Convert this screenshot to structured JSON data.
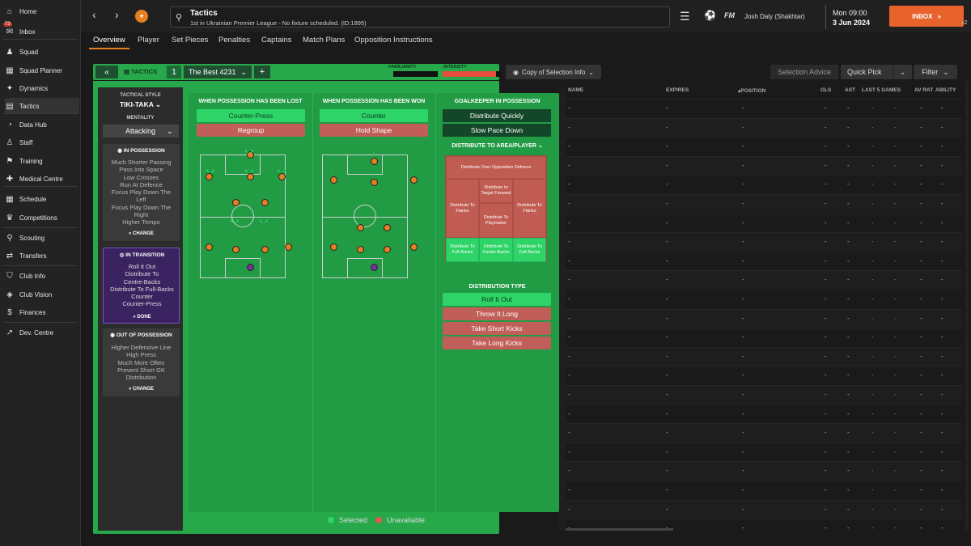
{
  "sidebar": {
    "items": [
      {
        "label": "Home",
        "icon": "home-icon"
      },
      {
        "label": "Inbox",
        "icon": "inbox-icon",
        "badge": "73"
      },
      {
        "label": "Squad",
        "icon": "squad-icon"
      },
      {
        "label": "Squad Planner",
        "icon": "planner-icon"
      },
      {
        "label": "Dynamics",
        "icon": "dynamics-icon"
      },
      {
        "label": "Tactics",
        "icon": "tactics-icon",
        "active": true
      },
      {
        "label": "Data Hub",
        "icon": "data-hub-icon"
      },
      {
        "label": "Staff",
        "icon": "staff-icon"
      },
      {
        "label": "Training",
        "icon": "training-icon"
      },
      {
        "label": "Medical Centre",
        "icon": "medical-icon"
      },
      {
        "label": "Schedule",
        "icon": "calendar-icon"
      },
      {
        "label": "Competitions",
        "icon": "trophy-icon"
      },
      {
        "label": "Scouting",
        "icon": "scouting-icon"
      },
      {
        "label": "Transfers",
        "icon": "transfers-icon"
      },
      {
        "label": "Club Info",
        "icon": "shield-icon"
      },
      {
        "label": "Club Vision",
        "icon": "vision-icon"
      },
      {
        "label": "Finances",
        "icon": "finances-icon"
      },
      {
        "label": "Dev. Centre",
        "icon": "dev-centre-icon"
      }
    ]
  },
  "topbar": {
    "title": "Tactics",
    "subtitle": "1st in Ukrainian Premier League - No fixture scheduled. (ID:1895)",
    "fm_logo": "FM",
    "manager": "Josh Daly (Shakhtar)",
    "date_day": "Mon 09:00",
    "date": "3 Jun 2024",
    "inbox_label": "INBOX",
    "bell_count": "2"
  },
  "tabs": [
    "Overview",
    "Player",
    "Set Pieces",
    "Penalties",
    "Captains",
    "Match Plans",
    "Opposition Instructions"
  ],
  "tactics_bar": {
    "label": "TACTICS",
    "slot": "1",
    "name": "The Best 4231",
    "familiarity_label": "FAMILIARITY",
    "intensity_label": "INTENSITY",
    "familiarity": 0.12,
    "intensity": 0.92
  },
  "left_panel": {
    "style_label": "TACTICAL STYLE",
    "style": "TIKI-TAKA",
    "mentality_label": "MENTALITY",
    "mentality": "Attacking",
    "in_possession": {
      "title": "IN POSSESSION",
      "lines": [
        "Much Shorter Passing",
        "Pass Into Space",
        "Low Crosses",
        "Run At Defence",
        "Focus Play Down The",
        "Left",
        "Focus Play Down The",
        "Right",
        "Higher Tempo"
      ],
      "action": "CHANGE"
    },
    "in_transition": {
      "title": "IN TRANSITION",
      "lines": [
        "Roll It Out",
        "Distribute To",
        "Centre-Backs",
        "Distribute To Full-Backs",
        "Counter",
        "Counter-Press"
      ],
      "action": "DONE"
    },
    "out_of_possession": {
      "title": "OUT OF POSSESSION",
      "lines": [
        "Higher Defensive Line",
        "High Press",
        "Much More Often",
        "Prevent Short GK",
        "Distribution"
      ],
      "action": "CHANGE"
    }
  },
  "transition": {
    "lost": {
      "title": "WHEN POSSESSION HAS BEEN LOST",
      "options": [
        {
          "label": "Counter-Press",
          "state": "selected"
        },
        {
          "label": "Regroup",
          "state": "unavailable"
        }
      ]
    },
    "won": {
      "title": "WHEN POSSESSION HAS BEEN WON",
      "options": [
        {
          "label": "Counter",
          "state": "selected"
        },
        {
          "label": "Hold Shape",
          "state": "unavailable"
        }
      ]
    },
    "goalkeeper": {
      "title": "GOALKEEPER IN POSSESSION",
      "options": [
        {
          "label": "Distribute Quickly",
          "state": "dark"
        },
        {
          "label": "Slow Pace Down",
          "state": "dark"
        }
      ]
    },
    "distribute_area": {
      "title": "DISTRIBUTE TO AREA/PLAYER",
      "cells": [
        "Distribute Over Opposition Defence",
        "Distribute to Target Forward",
        "Distribute To Flanks",
        "Distribute To Flanks",
        "Distribute To Playmaker",
        "Distribute To Full-Backs",
        "Distribute To Centre-Backs",
        "Distribute To Full-Backs"
      ]
    },
    "distribution_type": {
      "title": "DISTRIBUTION TYPE",
      "options": [
        {
          "label": "Roll It Out",
          "state": "selected"
        },
        {
          "label": "Throw It Long",
          "state": "unavailable"
        },
        {
          "label": "Take Short Kicks",
          "state": "unavailable"
        },
        {
          "label": "Take Long Kicks",
          "state": "unavailable"
        }
      ]
    }
  },
  "legend": {
    "selected": "Selected",
    "unavailable": "Unavailable"
  },
  "right": {
    "selection_info": "Copy of Selection Info",
    "selection_advice": "Selection Advice",
    "quick_pick": "Quick Pick",
    "filter": "Filter",
    "headers": [
      "NAME",
      "EXPIRES",
      "POSITION",
      "GLS",
      "AST",
      "LAST 5 GAMES",
      "AV RAT",
      "ABILITY"
    ]
  },
  "colors": {
    "accent": "#e8622c",
    "green": "#27a84a",
    "selected": "#2ed468",
    "unavailable": "#c15e58"
  }
}
